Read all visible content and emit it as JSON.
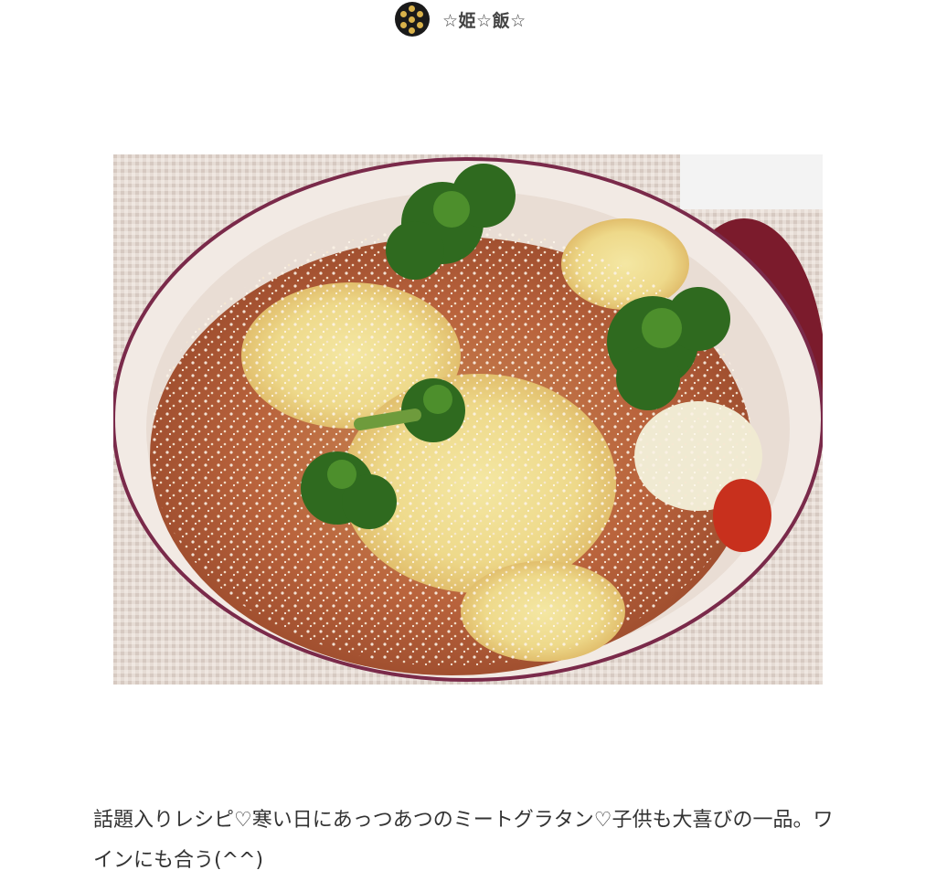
{
  "author": {
    "name": "☆姫☆飯☆",
    "avatar_icon": "user-avatar-icon"
  },
  "recipe": {
    "photo_icon": "recipe-photo-meat-gratin",
    "description": "話題入りレシピ♡寒い日にあっつあつのミートグラタン♡子供も大喜びの一品。ワインにも合う(^^)"
  },
  "colors": {
    "text": "#333333",
    "avatar_bg": "#1a1a1a",
    "avatar_accent": "#d9b24a"
  }
}
